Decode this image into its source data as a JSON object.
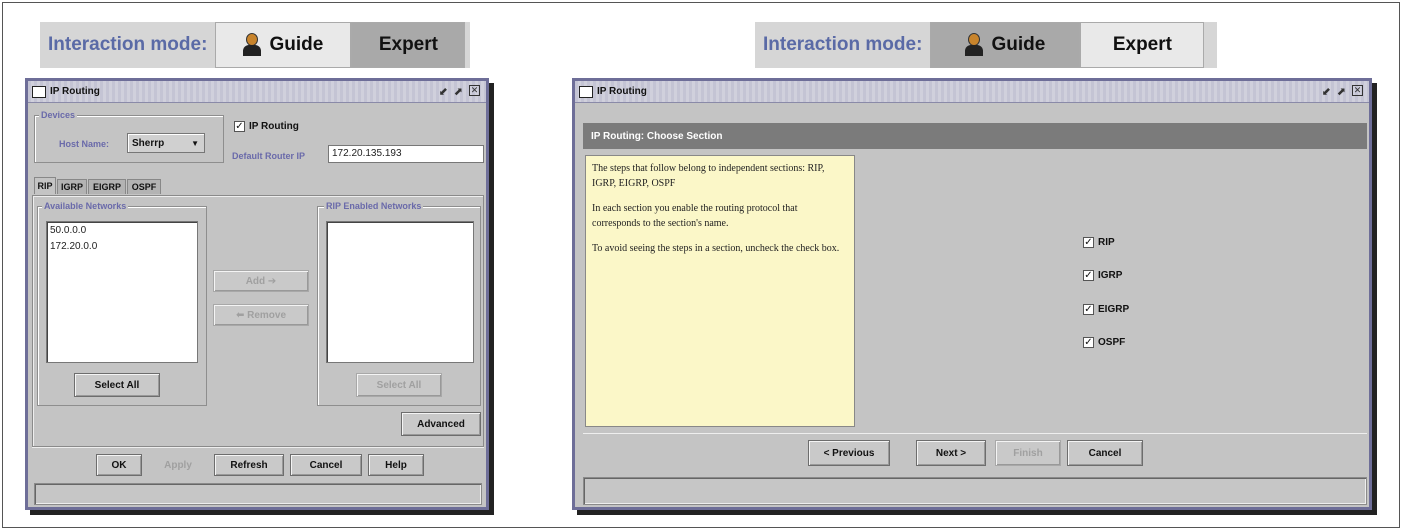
{
  "left": {
    "mode_bar": {
      "label": "Interaction mode:",
      "guide": "Guide",
      "expert": "Expert"
    },
    "window": {
      "title": "IP Routing",
      "devices_group": "Devices",
      "host_name_label": "Host Name:",
      "host_name_value": "Sherrp",
      "ip_routing_label": "IP Routing",
      "default_router_label": "Default Router IP",
      "default_router_value": "172.20.135.193",
      "tabs": [
        "RIP",
        "IGRP",
        "EIGRP",
        "OSPF"
      ],
      "available_networks_title": "Available Networks",
      "available_networks": [
        "50.0.0.0",
        "172.20.0.0"
      ],
      "rip_enabled_title": "RIP Enabled Networks",
      "add_label": "Add",
      "remove_label": "Remove",
      "select_all_label": "Select All",
      "select_all_right_label": "Select All",
      "advanced_label": "Advanced",
      "buttons": {
        "ok": "OK",
        "apply": "Apply",
        "refresh": "Refresh",
        "cancel": "Cancel",
        "help": "Help"
      }
    }
  },
  "right": {
    "mode_bar": {
      "label": "Interaction mode:",
      "guide": "Guide",
      "expert": "Expert"
    },
    "window": {
      "title": "IP Routing",
      "section_header": "IP Routing: Choose Section",
      "help_paragraphs": [
        "The steps that follow belong to independent sections: RIP, IGRP, EIGRP, OSPF",
        "In each section you enable the routing protocol that corresponds to the section's name.",
        "To avoid seeing the steps in a section, uncheck the check box."
      ],
      "checkboxes": [
        "RIP",
        "IGRP",
        "EIGRP",
        "OSPF"
      ],
      "buttons": {
        "previous": "< Previous",
        "next": "Next >",
        "finish": "Finish",
        "cancel": "Cancel"
      }
    }
  },
  "colors": {
    "mode_label": "#5a6aa6",
    "window_border": "#6e6e98",
    "help_bg": "#fbf7c8",
    "header_strip": "#7b7b7b"
  }
}
